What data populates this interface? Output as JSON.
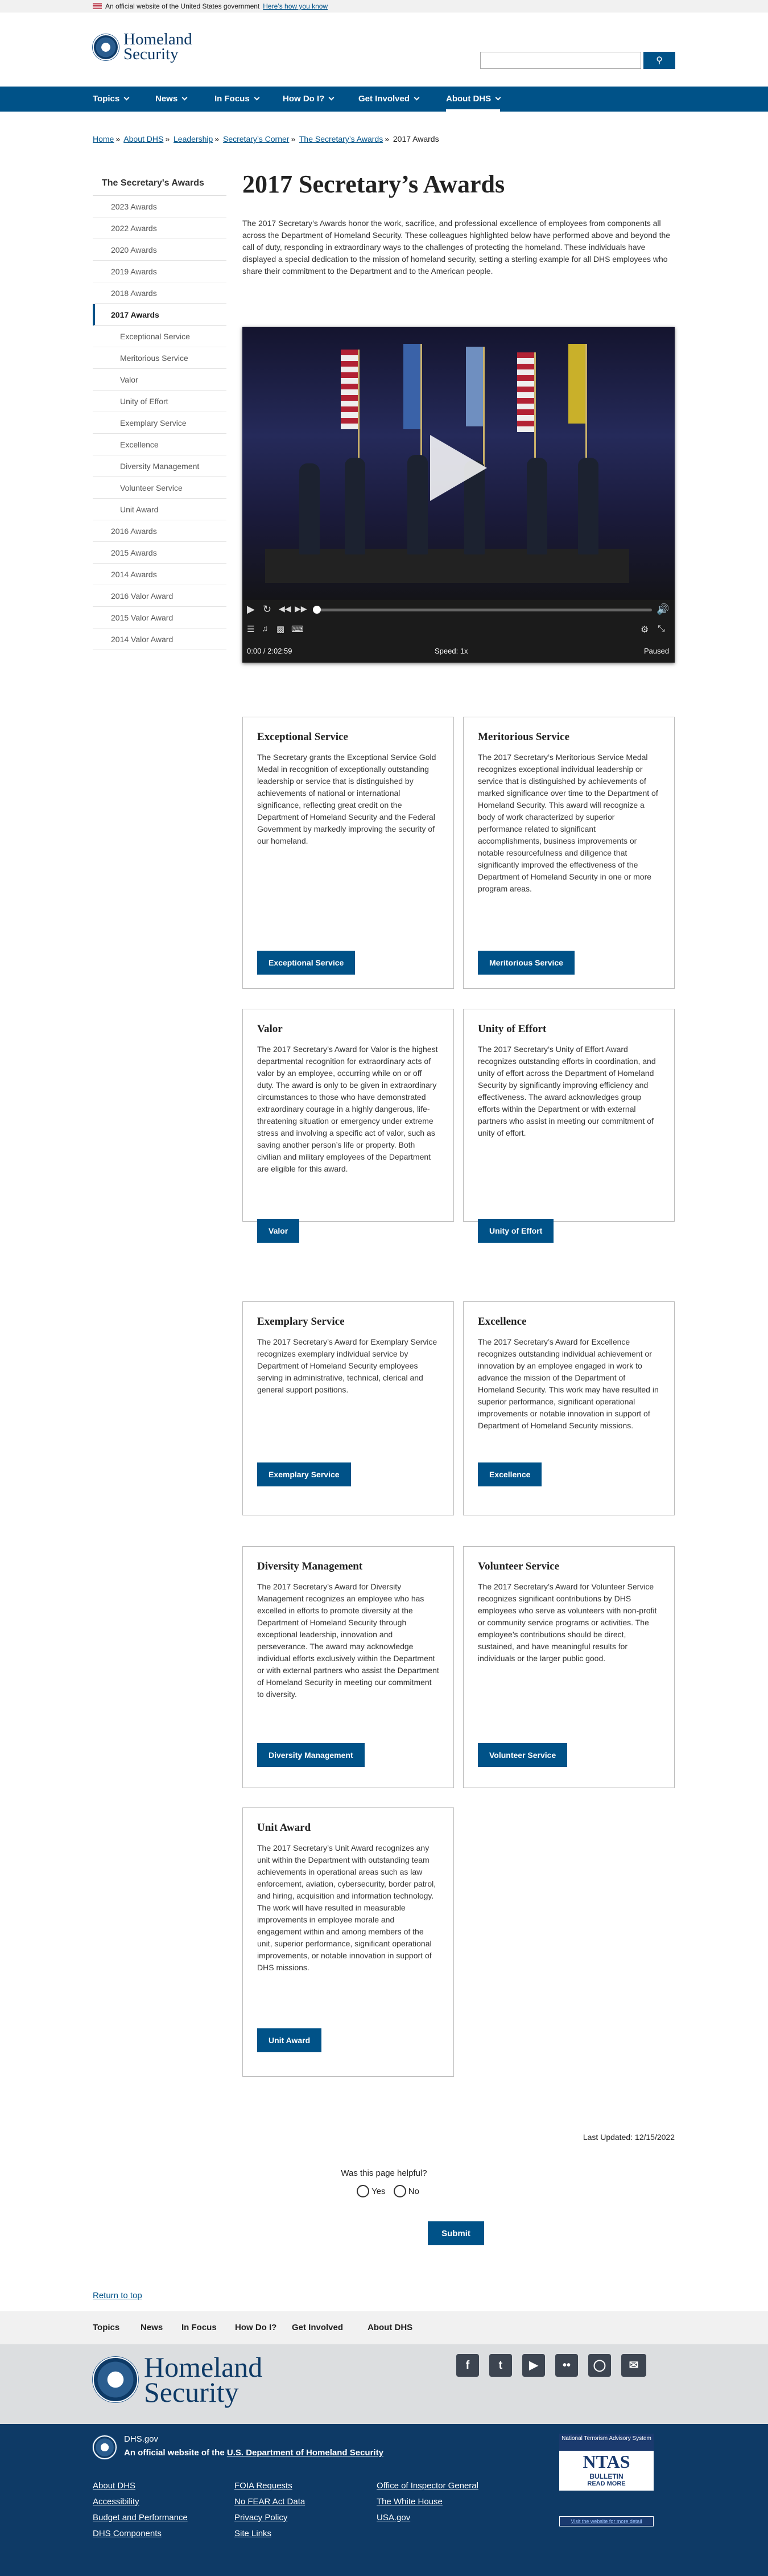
{
  "gov_banner": {
    "text": "An official website of the United States government",
    "link": "Here’s how you know"
  },
  "header": {
    "brand_line1": "Homeland",
    "brand_line2": "Security",
    "search_placeholder": "",
    "search_button_icon": "search-icon"
  },
  "nav": [
    {
      "label": "Topics"
    },
    {
      "label": "News"
    },
    {
      "label": "In Focus"
    },
    {
      "label": "How Do I?"
    },
    {
      "label": "Get Involved"
    },
    {
      "label": "About DHS"
    }
  ],
  "breadcrumb": [
    "Home",
    "About DHS",
    "Leadership",
    "Secretary’s Corner",
    "The Secretary’s Awards",
    "2017 Awards"
  ],
  "sidenav": {
    "header": "The Secretary's Awards",
    "items": [
      {
        "label": "2023 Awards",
        "level": 1
      },
      {
        "label": "2022 Awards",
        "level": 1
      },
      {
        "label": "2020 Awards",
        "level": 1
      },
      {
        "label": "2019 Awards",
        "level": 1
      },
      {
        "label": "2018 Awards",
        "level": 1
      },
      {
        "label": "2017 Awards",
        "level": 1,
        "current": true
      },
      {
        "label": "Exceptional Service",
        "level": 2
      },
      {
        "label": "Meritorious Service",
        "level": 2
      },
      {
        "label": "Valor",
        "level": 2
      },
      {
        "label": "Unity of Effort",
        "level": 2
      },
      {
        "label": "Exemplary Service",
        "level": 2
      },
      {
        "label": "Excellence",
        "level": 2
      },
      {
        "label": "Diversity Management",
        "level": 2
      },
      {
        "label": "Volunteer Service",
        "level": 2
      },
      {
        "label": "Unit Award",
        "level": 2
      },
      {
        "label": "2016 Awards",
        "level": 1
      },
      {
        "label": "2015 Awards",
        "level": 1
      },
      {
        "label": "2014 Awards",
        "level": 1
      },
      {
        "label": "2016 Valor Award",
        "level": 1
      },
      {
        "label": "2015 Valor Award",
        "level": 1
      },
      {
        "label": "2014 Valor Award",
        "level": 1
      }
    ]
  },
  "page": {
    "title": "2017 Secretary’s Awards",
    "intro": "The 2017 Secretary’s Awards honor the work, sacrifice, and professional excellence of employees from components all across the Department of Homeland Security.  These colleagues highlighted below have performed above and beyond the call of duty, responding in extraordinary ways to the challenges of protecting the homeland.  These individuals have displayed a special dedication to the mission of homeland security, setting a sterling example for all DHS employees who share their commitment to the Department and to the American people."
  },
  "video": {
    "time": "0:00 / 2:02:59",
    "speed": "Speed: 1x",
    "state": "Paused",
    "progress": 0
  },
  "cards": [
    {
      "title": "Exceptional Service",
      "body": "The Secretary grants the Exceptional Service Gold Medal in recognition of exceptionally outstanding leadership or service that is distinguished by achievements of national or international significance, reflecting great credit on the Department of Homeland Security and the Federal Government by markedly improving the security of our homeland.",
      "button": "Exceptional Service"
    },
    {
      "title": "Meritorious Service",
      "body": "The 2017 Secretary’s Meritorious Service Medal recognizes exceptional individual leadership or service that is distinguished by achievements of marked significance over time to the Department of Homeland Security. This award will recognize a body of work characterized by superior performance related to significant accomplishments, business improvements or notable resourcefulness and diligence that significantly improved the effectiveness of the Department of Homeland Security in one or more program areas.",
      "button": "Meritorious Service"
    },
    {
      "title": "Valor",
      "body": "The 2017 Secretary’s Award for Valor is the highest departmental recognition for extraordinary acts of valor by an employee, occurring while on or off duty. The award is only to be given in extraordinary circumstances to those who have demonstrated extraordinary courage in a highly dangerous, life-threatening situation or emergency under extreme stress and involving a specific act of valor, such as saving another person’s life or property. Both civilian and military employees of the Department are eligible for this award.",
      "button": "Valor"
    },
    {
      "title": "Unity of Effort",
      "body": "The 2017 Secretary’s Unity of Effort Award recognizes outstanding efforts in coordination, and unity of effort across the Department of Homeland Security by significantly improving efficiency and effectiveness. The award acknowledges group efforts within the Department or with external partners who assist in meeting our commitment of unity of effort.",
      "button": "Unity of Effort"
    },
    {
      "title": "Exemplary Service",
      "body": "The 2017 Secretary’s Award for Exemplary Service recognizes exemplary individual service by Department of Homeland Security employees serving in administrative, technical, clerical and general support positions.",
      "button": "Exemplary Service"
    },
    {
      "title": "Excellence",
      "body": "The 2017 Secretary’s Award for Excellence recognizes outstanding individual achievement or innovation by an employee engaged in work to advance the mission of the Department of Homeland Security. This work may have resulted in superior performance, significant operational improvements or notable innovation in support of Department of Homeland Security missions.",
      "button": "Excellence"
    },
    {
      "title": "Diversity Management",
      "body": "The 2017 Secretary’s Award for Diversity Management recognizes an employee who has excelled in efforts to promote diversity at the Department of Homeland Security through exceptional leadership, innovation and perseverance. The award may acknowledge individual efforts exclusively within the Department or with external partners who assist the Department of Homeland Security in meeting our commitment to diversity.",
      "button": "Diversity Management"
    },
    {
      "title": "Volunteer Service",
      "body": "The 2017 Secretary’s Award for Volunteer Service recognizes significant contributions by DHS employees who serve as volunteers with non-profit or community service programs or activities. The employee’s contributions should be direct, sustained, and have meaningful results for individuals or the larger public good.",
      "button": "Volunteer Service"
    },
    {
      "title": "Unit Award",
      "body": "The 2017 Secretary’s Unit Award recognizes any unit within the Department with outstanding team achievements in operational areas such as law enforcement, aviation, cybersecurity, border patrol, and hiring, acquisition and information technology. The work will have resulted in measurable improvements in employee morale and engagement within and among members of the unit, superior performance, significant operational improvements, or notable innovation in support of DHS missions.",
      "button": "Unit Award"
    }
  ],
  "last_updated": "Last Updated: 12/15/2022",
  "feedback": {
    "question": "Was this page helpful?",
    "yes": "Yes",
    "no": "No",
    "submit": "Submit"
  },
  "return_to_top": "Return to top",
  "footer_nav": [
    {
      "label": "Topics"
    },
    {
      "label": "News"
    },
    {
      "label": "In Focus"
    },
    {
      "label": "How Do I?"
    },
    {
      "label": "Get Involved"
    },
    {
      "label": "About DHS"
    }
  ],
  "social": [
    "facebook-icon",
    "twitter-icon",
    "youtube-icon",
    "flickr-icon",
    "instagram-icon",
    "email-icon"
  ],
  "footer": {
    "site": "DHS.gov",
    "official_prefix": "An official website of the ",
    "official_link": "U.S. Department of Homeland Security",
    "links": [
      [
        "About DHS",
        "Accessibility",
        "Budget and Performance",
        "DHS Components"
      ],
      [
        "FOIA Requests",
        "No FEAR Act Data",
        "Privacy Policy",
        "Site Links"
      ],
      [
        "Office of Inspector General",
        "The White House",
        "USA.gov"
      ]
    ],
    "ntas": {
      "top": "National Terrorism Advisory System",
      "logo": "NTAS",
      "bulletin": "BULLETIN",
      "read_more": "READ MORE",
      "bottom": "Visit the website for more detail"
    }
  }
}
